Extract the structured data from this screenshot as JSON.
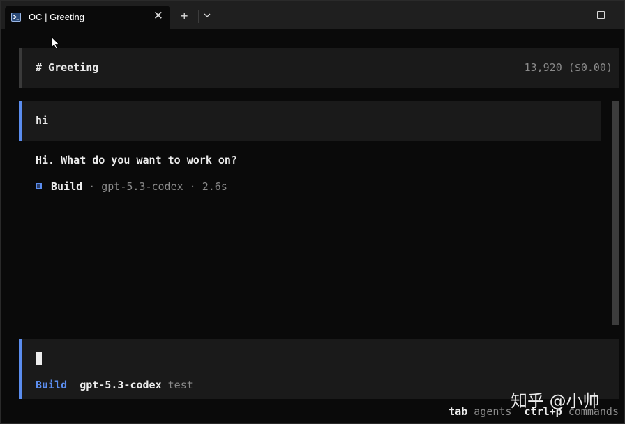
{
  "window": {
    "tab_title": "OC | Greeting",
    "tab_close": "✕",
    "new_tab": "+"
  },
  "session": {
    "title": "# Greeting",
    "cost": "13,920 ($0.00)"
  },
  "messages": {
    "user": "hi",
    "assistant": "Hi. What do you want to work on?",
    "status": {
      "agent": "Build",
      "separator1": " · ",
      "model": "gpt-5.3-codex",
      "separator2": " · ",
      "duration": "2.6s"
    }
  },
  "input": {
    "agent": "Build",
    "model": "gpt-5.3-codex",
    "provider": "test"
  },
  "hints": {
    "tab_key": "tab",
    "tab_label": "agents",
    "cmd_key": "ctrl+p",
    "cmd_label": "commands"
  },
  "watermark": "知乎 @小帅",
  "colors": {
    "accent": "#5b8def",
    "muted": "#8a8a8a",
    "panel": "#1a1a1a",
    "background": "#0a0a0a"
  }
}
